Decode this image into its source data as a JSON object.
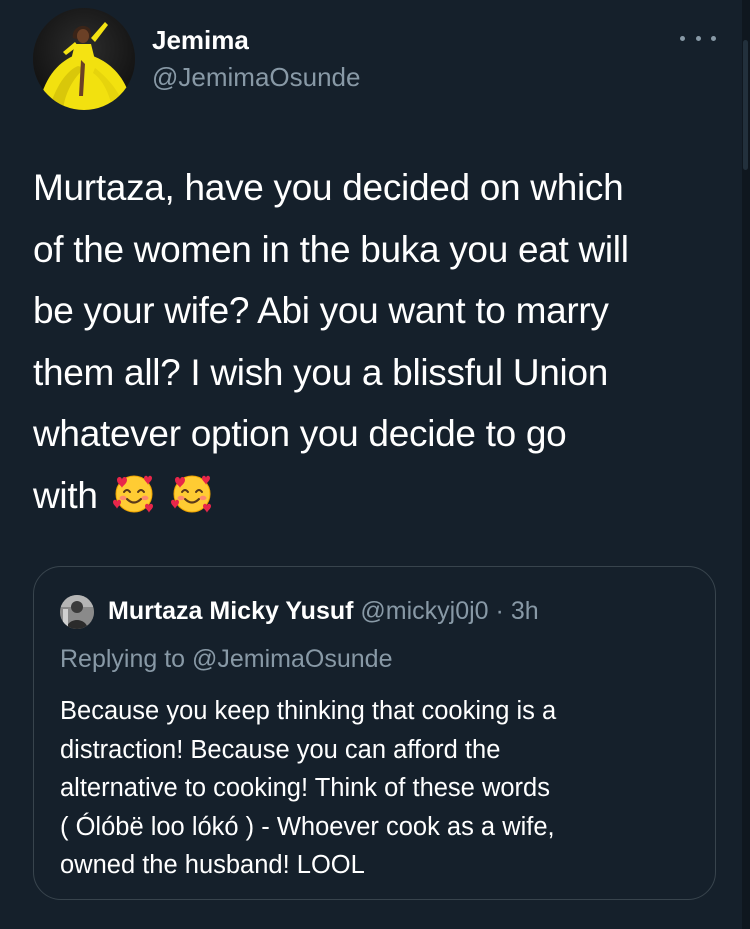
{
  "tweet": {
    "author": {
      "name": "Jemima",
      "handle": "@JemimaOsunde",
      "avatar": "avatar-woman-yellow-dress"
    },
    "menu_icon": "more-horizontal-icon",
    "text_lines": [
      "Murtaza, have you decided on which",
      "of the women in the buka you eat will",
      "be your wife? Abi you want to marry",
      "them all? I wish you a blissful Union",
      "whatever option you decide to go",
      "with"
    ],
    "emojis": [
      "smiling-face-with-hearts-icon",
      "smiling-face-with-hearts-icon"
    ]
  },
  "quoted_tweet": {
    "author_name": "Murtaza Micky Yusuf",
    "author_handle": "@mickyj0j0",
    "separator": "·",
    "time": "3h",
    "replying_to": "Replying to @JemimaOsunde",
    "text_lines": [
      "Because you keep thinking that cooking is a",
      "distraction! Because you can afford the",
      "alternative to cooking! Think of these words",
      "( Ólóbë loo lókó ) - Whoever cook as a wife,",
      "owned the husband! LOOL"
    ]
  },
  "colors": {
    "background": "#15202b",
    "text_primary": "#ffffff",
    "text_secondary": "#8899a6",
    "border": "#38444d",
    "avatar_dress": "#f5e312"
  }
}
